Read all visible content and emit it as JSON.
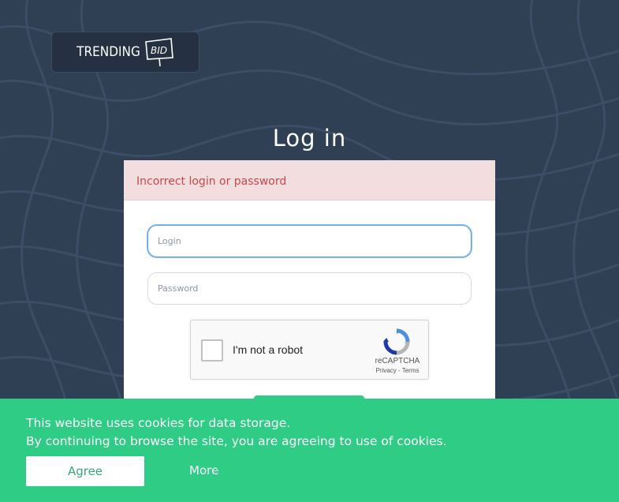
{
  "logo": {
    "word": "TRENDING",
    "mark_text": "BID"
  },
  "page": {
    "title": "Log in"
  },
  "alert": {
    "message": "Incorrect login or password"
  },
  "form": {
    "login_placeholder": "Login",
    "login_value": "",
    "password_placeholder": "Password",
    "password_value": ""
  },
  "captcha": {
    "label": "I'm not a robot",
    "brand": "reCAPTCHA",
    "terms": "Privacy - Terms",
    "checked": false
  },
  "cookie": {
    "line1": "This website uses cookies for data storage.",
    "line2": "By continuing to browse the site, you are agreeing to use of cookies.",
    "agree_label": "Agree",
    "more_label": "More"
  },
  "colors": {
    "background": "#2f3f54",
    "accent_green": "#2ecc84",
    "alert_bg": "#f2dede",
    "alert_text": "#c9474a"
  }
}
